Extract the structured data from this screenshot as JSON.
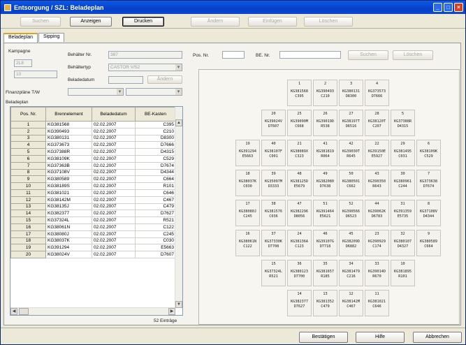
{
  "window": {
    "title": "Entsorgung / SZL:  Beladeplan"
  },
  "toolbar": {
    "buttons": [
      "Suchen",
      "Anzeigen",
      "Drucken",
      "Ändern",
      "Einfügen",
      "Löschen"
    ]
  },
  "tabs": [
    "Beladeplan",
    "Sipping"
  ],
  "form": {
    "kampagne_label": "Kampagne",
    "kampagne_value": "2L8",
    "field2": "10",
    "behaelter_nr_label": "Behälter Nr.",
    "behaelter_nr": "387",
    "behaeltertyp_label": "Behältertyp",
    "behaeltertyp": "CASTOR V/52",
    "beladedatum_label": "Beladedatum",
    "aendern_label": "Ändern",
    "finanzplaene_label": "Finanzpläne T/W",
    "beladeplan_label": "Beladeplan",
    "pos_nr_label": "Pos. Nr.",
    "be_nr_label": "BE. Nr.",
    "suchen_label": "Suchen",
    "loeschen_label": "Löschen"
  },
  "table": {
    "columns": [
      "Pos. Nr.",
      "Brennelement",
      "Beladedatum",
      "BE-Kasten"
    ],
    "rows": [
      [
        "1",
        "KG381568",
        "02.02.2007",
        "C395"
      ],
      [
        "2",
        "KG390493",
        "02.02.2007",
        "C210"
      ],
      [
        "3",
        "KG380131",
        "02.02.2007",
        "D8300"
      ],
      [
        "4",
        "KG373673",
        "02.02.2007",
        "D7666"
      ],
      [
        "5",
        "KG37388R",
        "02.02.2007",
        "D4315"
      ],
      [
        "6",
        "KG38109K",
        "02.02.2007",
        "C529"
      ],
      [
        "7",
        "KG37363B",
        "02.02.2007",
        "D7674"
      ],
      [
        "8",
        "KG37108V",
        "02.02.2007",
        "D4344"
      ],
      [
        "9",
        "KG380589",
        "02.02.2007",
        "C664"
      ],
      [
        "10",
        "KG38189S",
        "02.02.2007",
        "R101"
      ],
      [
        "11",
        "KG381021",
        "02.02.2007",
        "C646"
      ],
      [
        "12",
        "KG38142M",
        "02.02.2007",
        "C467"
      ],
      [
        "13",
        "KG38135J",
        "02.02.2007",
        "C479"
      ],
      [
        "14",
        "KG382377",
        "02.02.2007",
        "D7627"
      ],
      [
        "15",
        "KG37324L",
        "02.02.2007",
        "R521"
      ],
      [
        "16",
        "KG38061N",
        "02.02.2007",
        "C122"
      ],
      [
        "17",
        "KG38080J",
        "02.02.2007",
        "C245"
      ],
      [
        "18",
        "KG38037K",
        "02.02.2007",
        "C030"
      ],
      [
        "19",
        "KG391294",
        "02.02.2007",
        "E5663"
      ],
      [
        "20",
        "KG38024V",
        "02.02.2007",
        "D7607"
      ]
    ],
    "count_label": "52 Einträge"
  },
  "lattice": [
    [
      null,
      null,
      null,
      [
        "1",
        "KG381568",
        "C395"
      ],
      [
        "2",
        "KG390493",
        "C210"
      ],
      [
        "3",
        "KG380131",
        "D8300"
      ],
      [
        "4",
        "KG373573",
        "D7666"
      ],
      null,
      null
    ],
    [
      null,
      null,
      [
        "20",
        "KG39024V",
        "D7607"
      ],
      [
        "25",
        "KG39090M",
        "C668"
      ],
      [
        "26",
        "KG39019D",
        "R538"
      ],
      [
        "27",
        "KG38197T",
        "D6516"
      ],
      [
        "28",
        "KG38120T",
        "C207"
      ],
      [
        "5",
        "KG37388R",
        "D4315"
      ],
      null
    ],
    [
      null,
      [
        "19",
        "KG391294",
        "E5663"
      ],
      [
        "40",
        "KG38107F",
        "C001"
      ],
      [
        "21",
        "KG38089X",
        "C323"
      ],
      [
        "41",
        "KG381819",
        "R064"
      ],
      [
        "42",
        "KG39030T",
        "R645"
      ],
      [
        "22",
        "KG39150E",
        "E5927"
      ],
      [
        "29",
        "KG381495",
        "C031"
      ],
      [
        "6",
        "KG38109K",
        "C529"
      ]
    ],
    [
      null,
      [
        "18",
        "KG38037K",
        "C030"
      ],
      [
        "39",
        "KG35097M",
        "D3333"
      ],
      [
        "48",
        "KG38125D",
        "E5679"
      ],
      [
        "49",
        "KG382080",
        "D7638"
      ],
      [
        "50",
        "KG380501",
        "C662"
      ],
      [
        "43",
        "KG390350",
        "R643"
      ],
      [
        "30",
        "KG380961",
        "C244"
      ],
      [
        "7",
        "KG373638",
        "D7674"
      ]
    ],
    [
      null,
      [
        "17",
        "KG38080J",
        "C245"
      ],
      [
        "38",
        "KG381576",
        "C036"
      ],
      [
        "47",
        "KG382296",
        "D8056"
      ],
      [
        "51",
        "KG391464",
        "E5621"
      ],
      [
        "52",
        "KG390566",
        "D6523"
      ],
      [
        "44",
        "KG39062K",
        "D6783"
      ],
      [
        "31",
        "KG391359",
        "E5735"
      ],
      [
        "8",
        "KG37108V",
        "D4344"
      ]
    ],
    [
      null,
      [
        "16",
        "KG38061N",
        "C122"
      ],
      [
        "37",
        "KG37330K",
        "D7708"
      ],
      [
        "24",
        "KG38136A",
        "C123"
      ],
      [
        "46",
        "KG39107G",
        "D7718"
      ],
      [
        "45",
        "KG38209D",
        "D6882"
      ],
      [
        "23",
        "KG390929",
        "C174"
      ],
      [
        "32",
        "KG380107",
        "D4327"
      ],
      [
        "9",
        "KG380589",
        "C664"
      ]
    ],
    [
      null,
      null,
      [
        "15",
        "KG37324L",
        "R521"
      ],
      [
        "36",
        "KG380123",
        "D7700"
      ],
      [
        "35",
        "KG381657",
        "R185"
      ],
      [
        "34",
        "KG381479",
        "C216"
      ],
      [
        "33",
        "KG39014D",
        "R670"
      ],
      [
        "10",
        "KG381895",
        "R101"
      ],
      null
    ],
    [
      null,
      null,
      null,
      [
        "14",
        "KG382377",
        "D7627"
      ],
      [
        "13",
        "KG381352",
        "C479"
      ],
      [
        "12",
        "KG38142M",
        "C467"
      ],
      [
        "11",
        "KG381021",
        "C646"
      ],
      null,
      null
    ]
  ],
  "footer": {
    "buttons": [
      "Bestätigen",
      "Hilfe",
      "Abbrechen"
    ]
  }
}
